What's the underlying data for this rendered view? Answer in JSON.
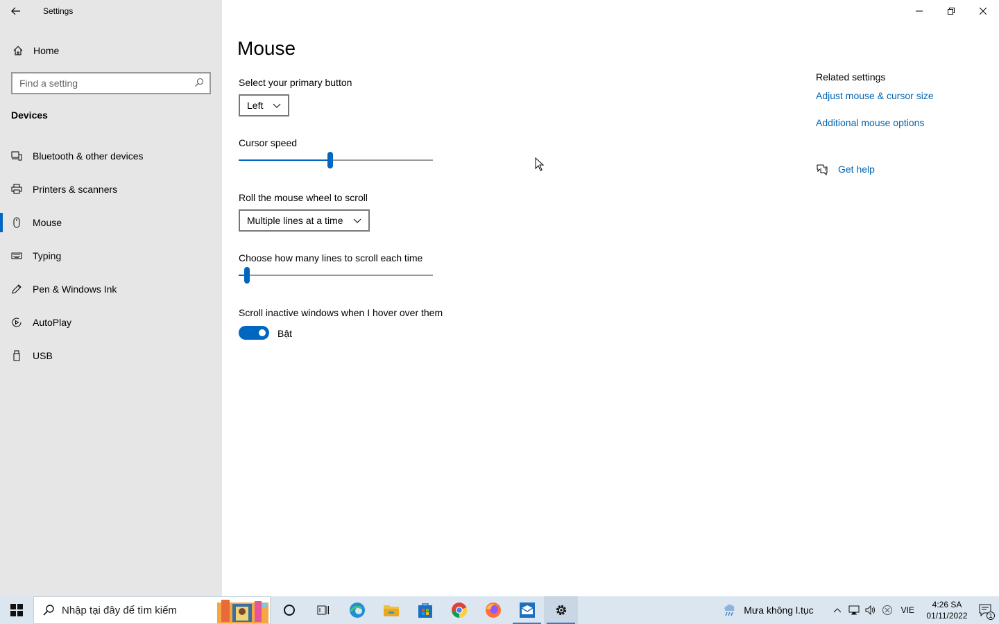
{
  "window": {
    "title": "Settings"
  },
  "sidebar": {
    "home_label": "Home",
    "search_placeholder": "Find a setting",
    "section": "Devices",
    "items": [
      {
        "label": "Bluetooth & other devices",
        "icon": "bluetooth-devices-icon"
      },
      {
        "label": "Printers & scanners",
        "icon": "printer-icon"
      },
      {
        "label": "Mouse",
        "icon": "mouse-icon",
        "active": true
      },
      {
        "label": "Typing",
        "icon": "keyboard-icon"
      },
      {
        "label": "Pen & Windows Ink",
        "icon": "pen-icon"
      },
      {
        "label": "AutoPlay",
        "icon": "autoplay-icon"
      },
      {
        "label": "USB",
        "icon": "usb-icon"
      }
    ]
  },
  "main": {
    "title": "Mouse",
    "primary_button": {
      "label": "Select your primary button",
      "value": "Left"
    },
    "cursor_speed": {
      "label": "Cursor speed",
      "fraction": 0.47
    },
    "wheel_scroll": {
      "label": "Roll the mouse wheel to scroll",
      "value": "Multiple lines at a time"
    },
    "lines_scroll": {
      "label": "Choose how many lines to scroll each time",
      "fraction": 0.03
    },
    "inactive_scroll": {
      "label": "Scroll inactive windows when I hover over them",
      "state_label": "Bật",
      "on": true
    }
  },
  "related": {
    "title": "Related settings",
    "links": [
      "Adjust mouse & cursor size",
      "Additional mouse options"
    ],
    "help": "Get help"
  },
  "taskbar": {
    "search_placeholder": "Nhập tại đây để tìm kiếm",
    "weather": "Mưa không l.tục",
    "language": "VIE",
    "time": "4:26 SA",
    "date": "01/11/2022",
    "notification_count": "1"
  },
  "colors": {
    "accent": "#0067c0",
    "link": "#0063b1",
    "sidebar_bg": "#e6e6e6",
    "taskbar_bg": "#dce6f0"
  }
}
